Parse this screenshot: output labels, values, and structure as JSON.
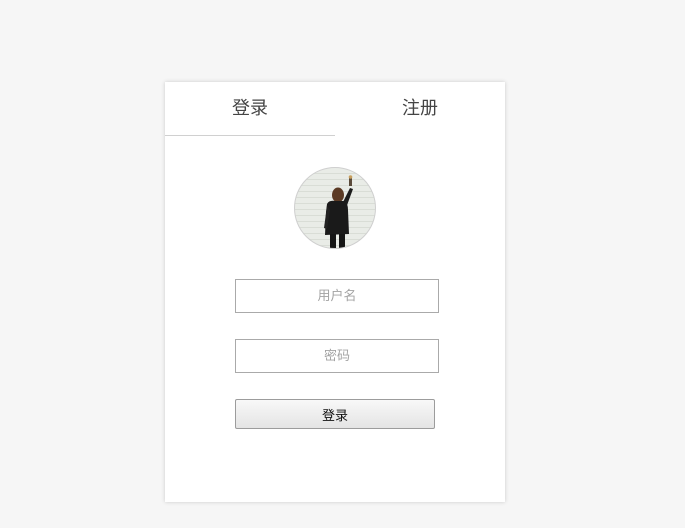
{
  "tabs": {
    "login": "登录",
    "register": "注册"
  },
  "avatar": {
    "description_icon": "profile-photo"
  },
  "form": {
    "username_placeholder": "用户名",
    "username_value": "",
    "password_placeholder": "密码",
    "password_value": "",
    "submit_label": "登录"
  },
  "colors": {
    "page_background": "#f6f6f6",
    "card_background": "#ffffff",
    "input_border": "#aaaaaa",
    "tab_underline": "#d0d0d0"
  }
}
